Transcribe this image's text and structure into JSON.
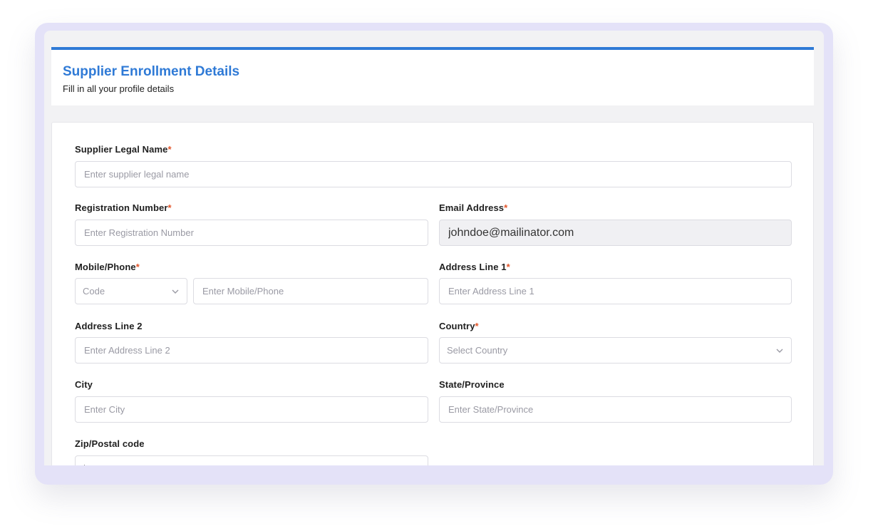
{
  "header": {
    "title": "Supplier Enrollment Details",
    "subtitle": "Fill in all your profile details"
  },
  "form": {
    "required_mark": "*",
    "legal_name": {
      "label": "Supplier Legal Name",
      "placeholder": "Enter supplier legal name",
      "value": ""
    },
    "registration_number": {
      "label": "Registration Number",
      "placeholder": "Enter Registration Number",
      "value": ""
    },
    "email": {
      "label": "Email Address",
      "value": "johndoe@mailinator.com"
    },
    "mobile": {
      "label": "Mobile/Phone",
      "code_placeholder": "Code",
      "placeholder": "Enter Mobile/Phone",
      "value": ""
    },
    "address1": {
      "label": "Address Line 1",
      "placeholder": "Enter Address Line 1",
      "value": ""
    },
    "address2": {
      "label": "Address Line 2",
      "placeholder": "Enter Address Line 2",
      "value": ""
    },
    "country": {
      "label": "Country",
      "placeholder": "Select Country"
    },
    "city": {
      "label": "City",
      "placeholder": "Enter City",
      "value": ""
    },
    "state": {
      "label": "State/Province",
      "placeholder": "Enter State/Province",
      "value": ""
    },
    "zip": {
      "label": "Zip/Postal code",
      "placeholder": "",
      "value": ""
    }
  },
  "colors": {
    "accent": "#2f7ad6",
    "required": "#e2552a",
    "frame": "#e4e2f8"
  }
}
